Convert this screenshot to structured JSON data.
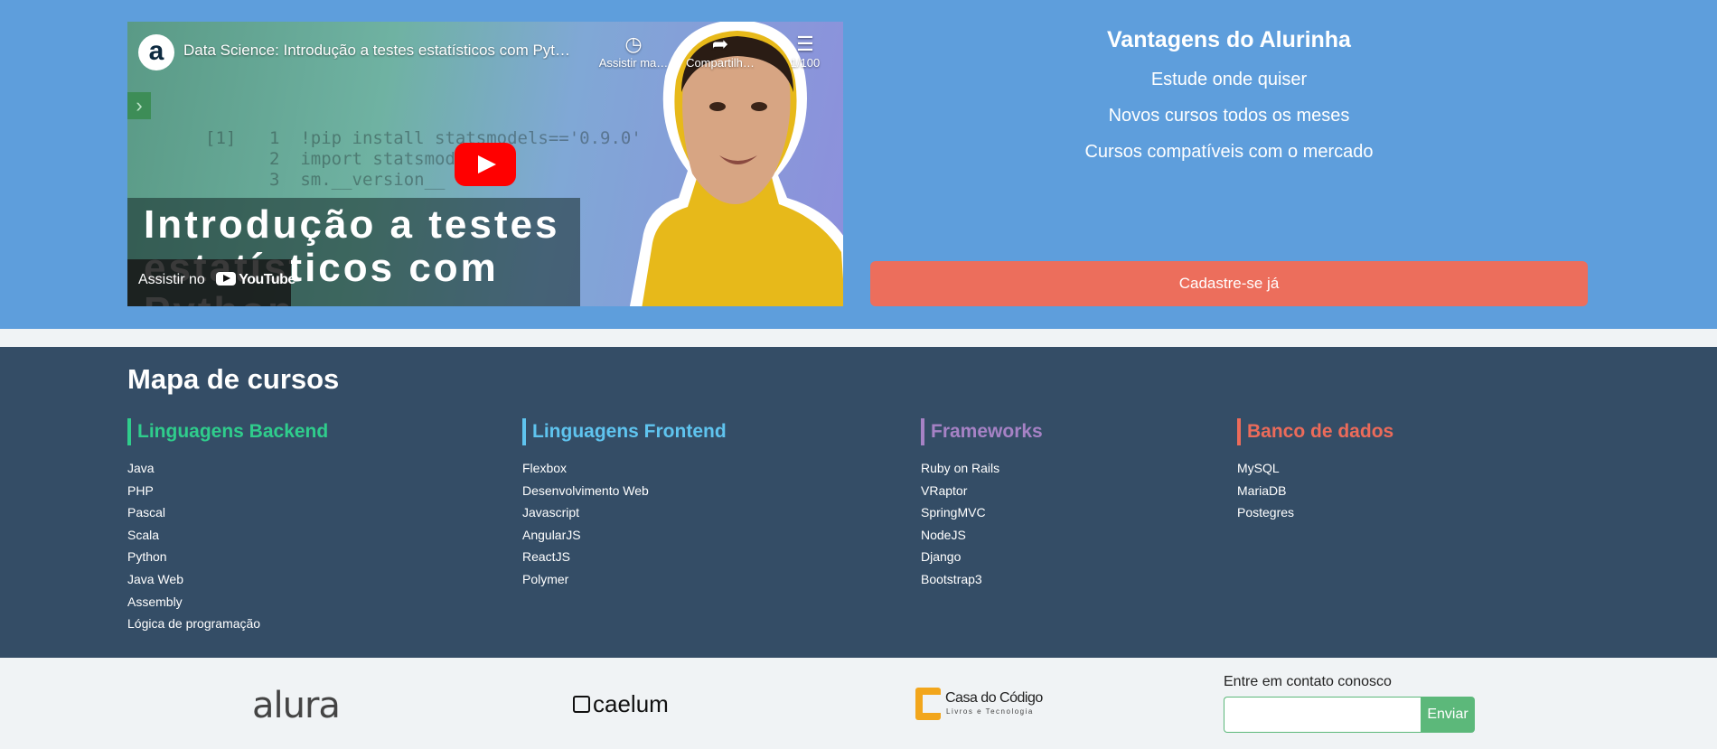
{
  "video": {
    "channel_logo": "a",
    "title": "Data Science: Introdução a testes estatísticos com Pyt…",
    "actions": [
      {
        "icon": "clock-icon",
        "label": "Assistir ma…"
      },
      {
        "icon": "share-icon",
        "label": "Compartilh…"
      },
      {
        "icon": "playlist-icon",
        "label": "1/100"
      }
    ],
    "thumbnail_code": [
      "[1]",
      "1  !pip install statsmodels=='0.9.0'",
      "2  import statsmodels",
      "3  sm.__version__"
    ],
    "overlay_text": "Introdução a testes\nestatísticos com\nPython",
    "watch_on_label": "Assistir no",
    "watch_on_brand": "YouTube"
  },
  "advantages": {
    "title": "Vantagens do Alurinha",
    "items": [
      "Estude onde quiser",
      "Novos cursos todos os meses",
      "Cursos compatíveis com o mercado"
    ],
    "cta_label": "Cadastre-se já"
  },
  "course_map": {
    "title": "Mapa de cursos",
    "columns": [
      {
        "title": "Linguagens Backend",
        "color": "#2fcd8c",
        "items": [
          "Java",
          "PHP",
          "Pascal",
          "Scala",
          "Python",
          "Java Web",
          "Assembly",
          "Lógica de programação"
        ]
      },
      {
        "title": "Linguagens Frontend",
        "color": "#5fc4ef",
        "items": [
          "Flexbox",
          "Desenvolvimento Web",
          "Javascript",
          "AngularJS",
          "ReactJS",
          "Polymer"
        ]
      },
      {
        "title": "Frameworks",
        "color": "#a682c5",
        "items": [
          "Ruby on Rails",
          "VRaptor",
          "SpringMVC",
          "NodeJS",
          "Django",
          "Bootstrap3"
        ]
      },
      {
        "title": "Banco de dados",
        "color": "#ec6b5a",
        "items": [
          "MySQL",
          "MariaDB",
          "Postegres"
        ]
      }
    ]
  },
  "footer": {
    "logos": {
      "alura": "alura",
      "caelum": "caelum",
      "cdc_title": "Casa do Código",
      "cdc_sub": "Livros e Tecnologia"
    },
    "contact_label": "Entre em contato conosco",
    "contact_placeholder": "",
    "submit_label": "Enviar"
  }
}
